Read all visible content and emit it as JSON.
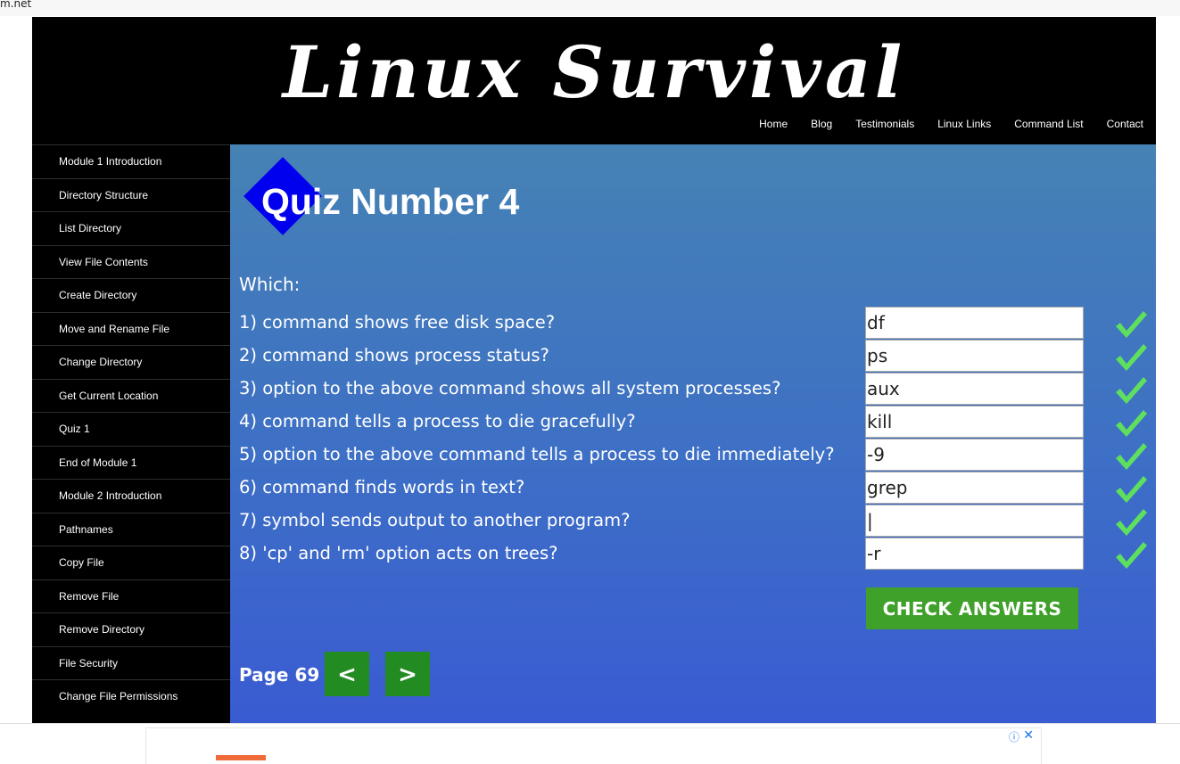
{
  "browser": {
    "url_fragment": "m.net"
  },
  "site": {
    "title": "Linux Survival"
  },
  "topnav": [
    "Home",
    "Blog",
    "Testimonials",
    "Linux Links",
    "Command List",
    "Contact"
  ],
  "sidebar": [
    "Module 1 Introduction",
    "Directory Structure",
    "List Directory",
    "View File Contents",
    "Create Directory",
    "Move and Rename File",
    "Change Directory",
    "Get Current Location",
    "Quiz 1",
    "End of Module 1",
    "Module 2 Introduction",
    "Pathnames",
    "Copy File",
    "Remove File",
    "Remove Directory",
    "File Security",
    "Change File Permissions"
  ],
  "quiz": {
    "title": "Quiz Number 4",
    "intro": "Which:",
    "questions": [
      {
        "text": "1) command shows free disk space?",
        "answer": "df"
      },
      {
        "text": "2) command shows process status?",
        "answer": "ps"
      },
      {
        "text": "3) option to the above command shows all system processes?",
        "answer": "aux"
      },
      {
        "text": "4) command tells a process to die gracefully?",
        "answer": "kill"
      },
      {
        "text": "5) option to the above command tells a process to die immediately?",
        "answer": "-9"
      },
      {
        "text": "6) command finds words in text?",
        "answer": "grep"
      },
      {
        "text": "7) symbol sends output to another program?",
        "answer": "|"
      },
      {
        "text": "8) 'cp' and 'rm' option acts on trees?",
        "answer": "-r"
      }
    ],
    "check_label": "CHECK ANSWERS",
    "check_icon": "checkmark-icon",
    "check_color": "#5ee05e"
  },
  "pager": {
    "label": "Page 69",
    "prev": "<",
    "next": ">"
  },
  "ad": {
    "info": "ⓘ",
    "close": "✕"
  }
}
